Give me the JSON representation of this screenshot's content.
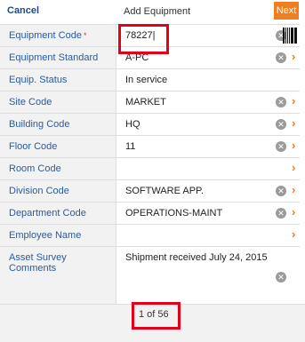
{
  "header": {
    "cancel_label": "Cancel",
    "title": "Add Equipment",
    "next_label": "Next"
  },
  "fields": [
    {
      "label": "Equipment Code",
      "required": "*",
      "value": "78227|"
    },
    {
      "label": "Equipment Standard",
      "value": "A-PC"
    },
    {
      "label": "Equip. Status",
      "value": "In service"
    },
    {
      "label": "Site Code",
      "value": "MARKET"
    },
    {
      "label": "Building Code",
      "value": "HQ"
    },
    {
      "label": "Floor Code",
      "value": "11"
    },
    {
      "label": "Room Code",
      "value": ""
    },
    {
      "label": "Division Code",
      "value": "SOFTWARE APP."
    },
    {
      "label": "Department Code",
      "value": "OPERATIONS-MAINT"
    },
    {
      "label": "Employee Name",
      "value": ""
    },
    {
      "label": "Asset Survey Comments",
      "value": "Shipment received July 24, 2015"
    }
  ],
  "footer": {
    "pager": "1 of 56"
  },
  "icons": {
    "clear": "clear-x-icon",
    "chevron": "chevron-right-icon",
    "barcode": "barcode-icon"
  },
  "colors": {
    "accent": "#f07d1e",
    "label_blue": "#2a5aa0",
    "highlight": "#e3001b"
  }
}
